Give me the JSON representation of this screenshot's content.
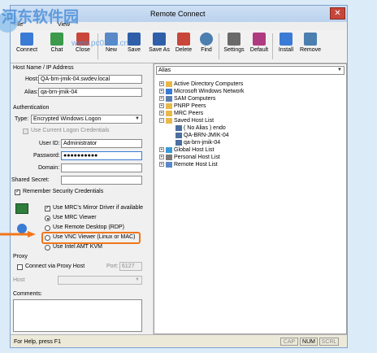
{
  "window": {
    "title": "Remote Connect",
    "close": "✕"
  },
  "watermark": {
    "text": "河东软件园",
    "url": "www.pc0359.cn"
  },
  "menu": [
    "File",
    "View"
  ],
  "toolbar": [
    {
      "label": "Connect",
      "icon": "monitor-icon",
      "color": "#3a7bd5"
    },
    {
      "label": "Chat",
      "icon": "chat-icon",
      "color": "#3c9a4a"
    },
    {
      "label": "Close",
      "icon": "close-connection-icon",
      "color": "#c8463a"
    },
    {
      "label": "New",
      "icon": "new-icon",
      "color": "#5a88c8"
    },
    {
      "label": "Save",
      "icon": "save-icon",
      "color": "#2f5fa8"
    },
    {
      "label": "Save As",
      "icon": "save-as-icon",
      "color": "#2f5fa8"
    },
    {
      "label": "Delete",
      "icon": "delete-icon",
      "color": "#c8463a"
    },
    {
      "label": "Find",
      "icon": "find-icon",
      "color": "#4a7fb0"
    },
    {
      "label": "Settings",
      "icon": "settings-icon",
      "color": "#6a6a6a"
    },
    {
      "label": "Default",
      "icon": "default-icon",
      "color": "#b03a80"
    },
    {
      "label": "Install",
      "icon": "install-icon",
      "color": "#3a7bd5"
    },
    {
      "label": "Remove",
      "icon": "remove-icon",
      "color": "#4a7fb0"
    }
  ],
  "host": {
    "group_label": "Host Name / IP Address",
    "host_label": "Host:",
    "host_value": "QA-brn-jmik-04.swdev.local",
    "alias_label": "Alias:",
    "alias_value": "qa-brn-jmik-04"
  },
  "auth": {
    "group_label": "Authentication",
    "type_label": "Type:",
    "type_value": "Encrypted Windows Logon",
    "use_current": "Use Current Logon Credentials",
    "user_label": "User ID:",
    "user_value": "Administrator",
    "password_label": "Password:",
    "password_value": "●●●●●●●●●●",
    "domain_label": "Domain:",
    "domain_value": "",
    "shared_label": "Shared Secret:",
    "shared_value": "",
    "remember": "Remember Security Credentials"
  },
  "viewer": {
    "mirror": "Use MRC's Mirror Driver if available",
    "mrc": "Use MRC Viewer",
    "rdp": "Use Remote Desktop (RDP)",
    "vnc": "Use VNC Viewer (Linux or MAC)",
    "amt": "Use Intel AMT KVM"
  },
  "proxy": {
    "group_label": "Proxy",
    "connect": "Connect via Proxy Host",
    "port_label": "Port:",
    "port_value": "6127",
    "host_label": "Host"
  },
  "comments": {
    "label": "Comments:"
  },
  "tree": {
    "header": "Alias",
    "items": [
      {
        "label": "Active Directory Computers",
        "level": 0,
        "plus": "+",
        "icon_color": "#e8b84a"
      },
      {
        "label": "Microsoft Windows Network",
        "level": 0,
        "plus": "+",
        "icon_color": "#3a7bd5"
      },
      {
        "label": "SAM Computers",
        "level": 0,
        "plus": "+",
        "icon_color": "#5a7fb0"
      },
      {
        "label": "PNRP Peers",
        "level": 0,
        "plus": "+",
        "icon_color": "#e8b84a"
      },
      {
        "label": "MRC Peers",
        "level": 0,
        "plus": "+",
        "icon_color": "#e8b84a"
      },
      {
        "label": "Saved Host List",
        "level": 0,
        "plus": "−",
        "icon_color": "#e8b84a"
      },
      {
        "label": "( No Alias ) endo",
        "level": 1,
        "plus": "",
        "icon_color": "#4a6fa0"
      },
      {
        "label": "QA-BRN-JMIK-04",
        "level": 1,
        "plus": "",
        "icon_color": "#4a6fa0"
      },
      {
        "label": "qa-brn-jmik-04",
        "level": 1,
        "plus": "",
        "icon_color": "#4a6fa0"
      },
      {
        "label": "Global Host List",
        "level": 0,
        "plus": "+",
        "icon_color": "#3a9ad5"
      },
      {
        "label": "Personal Host List",
        "level": 0,
        "plus": "+",
        "icon_color": "#7a7a7a"
      },
      {
        "label": "Remote Host List",
        "level": 0,
        "plus": "+",
        "icon_color": "#5a88c8"
      }
    ]
  },
  "status": {
    "help": "For Help, press F1",
    "cap": "CAP",
    "num": "NUM",
    "scrl": "SCRL"
  },
  "colors": {
    "accent": "#f0761c",
    "titlebar": "#b9d1ee",
    "close": "#c7463a"
  }
}
